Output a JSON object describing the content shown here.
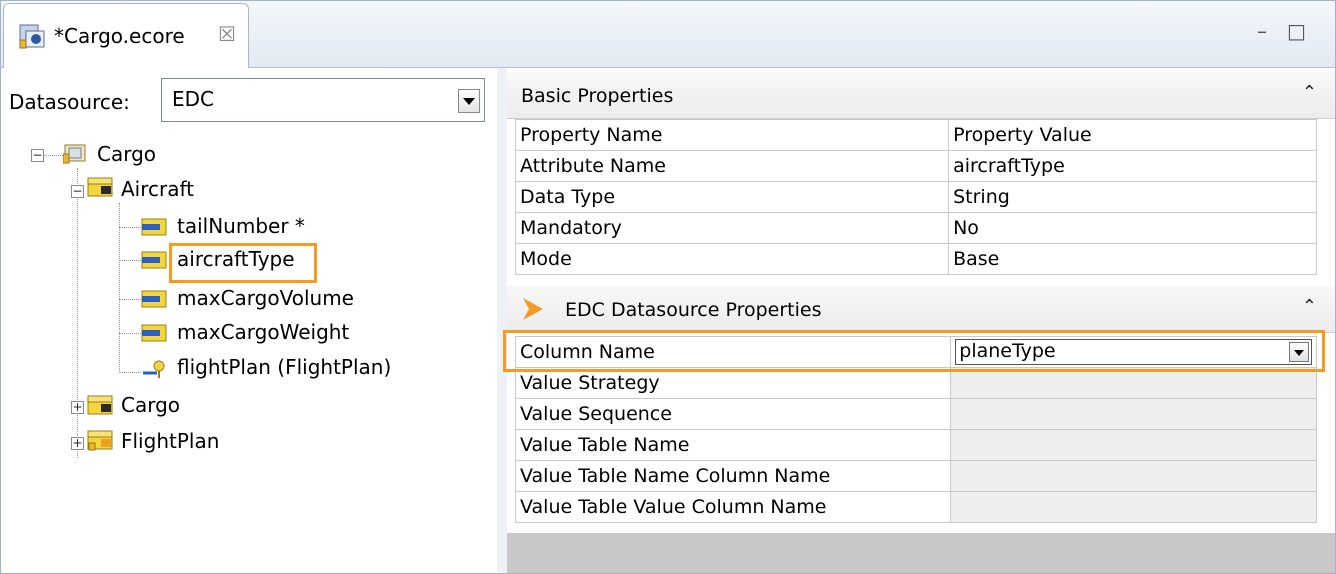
{
  "tab": {
    "title": "*Cargo.ecore",
    "close_symbol": "☒"
  },
  "window_buttons": {
    "minimize": "–",
    "maximize": "□"
  },
  "datasource": {
    "label": "Datasource:",
    "value": "EDC"
  },
  "tree": {
    "root": "Cargo",
    "class1": "Aircraft",
    "attrs": [
      "tailNumber *",
      "aircraftType",
      "maxCargoVolume",
      "maxCargoWeight"
    ],
    "ref": "flightPlan (FlightPlan)",
    "class2": "Cargo",
    "class3": "FlightPlan"
  },
  "basic": {
    "title": "Basic Properties",
    "headers": [
      "Property Name",
      "Property Value"
    ],
    "rows": [
      [
        "Attribute Name",
        "aircraftType"
      ],
      [
        "Data Type",
        "String"
      ],
      [
        "Mandatory",
        "No"
      ],
      [
        "Mode",
        "Base"
      ]
    ]
  },
  "edc": {
    "title": "EDC Datasource Properties",
    "column_name_label": "Column Name",
    "column_name_value": "planeType",
    "rows": [
      "Value Strategy",
      "Value Sequence",
      "Value Table Name",
      "Value Table Name Column Name",
      "Value Table Value Column Name"
    ]
  },
  "icons": {
    "collapse": "chevron-double-up-icon",
    "highlight_color": "#f59a23",
    "accent_chevron": "#f59a23"
  }
}
